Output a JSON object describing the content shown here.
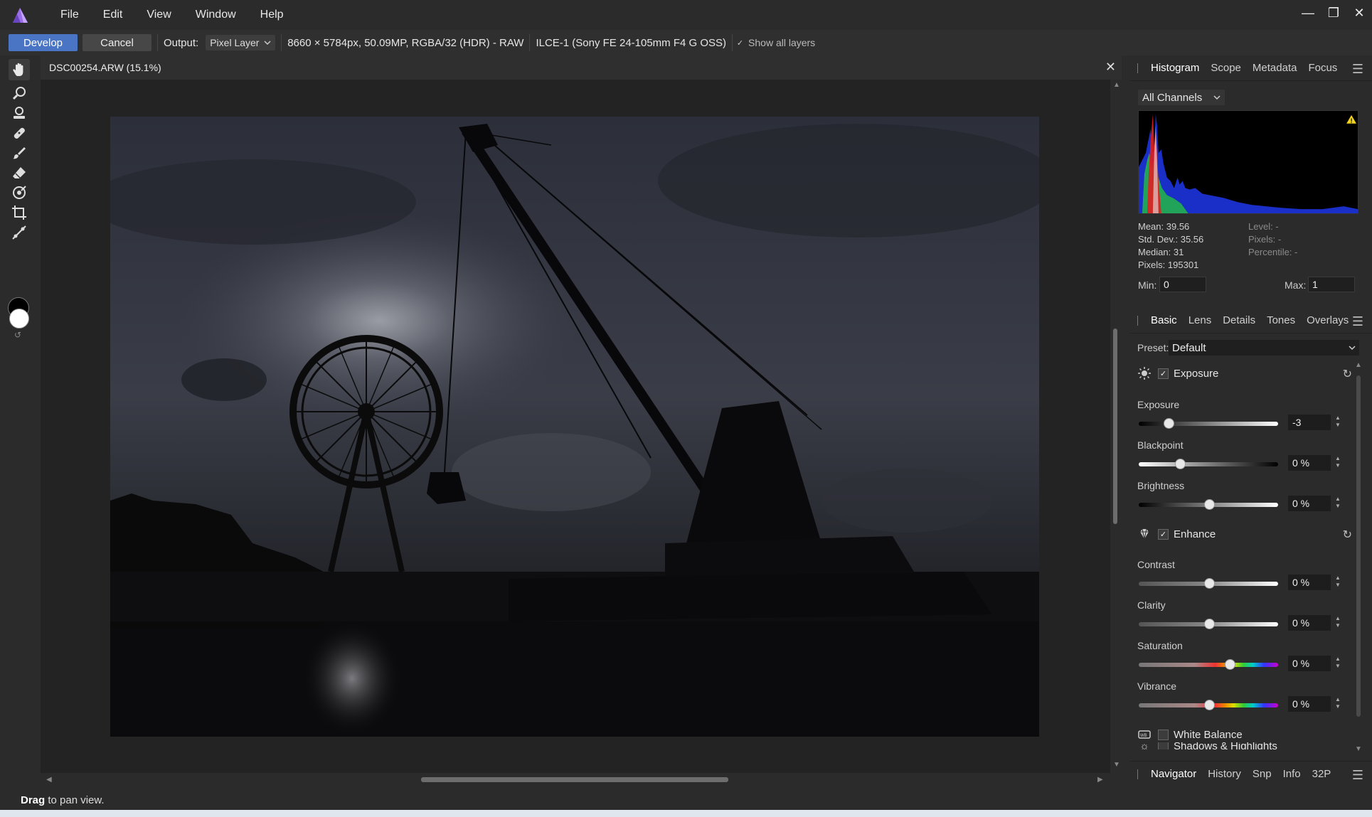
{
  "menu": {
    "items": [
      "File",
      "Edit",
      "View",
      "Window",
      "Help"
    ]
  },
  "window_controls": {
    "minimize": "—",
    "restore": "❐",
    "close": "✕"
  },
  "toolbar": {
    "develop_label": "Develop",
    "cancel_label": "Cancel",
    "output_label": "Output:",
    "output_value": "Pixel Layer",
    "image_info": "8660 × 5784px, 50.09MP, RGBA/32 (HDR) - RAW",
    "camera_info": "ILCE-1 (Sony FE 24-105mm F4 G OSS)",
    "show_layers_label": "Show all layers"
  },
  "tools": [
    {
      "name": "view-tool",
      "icon": "hand-icon",
      "active": true
    },
    {
      "name": "red-eye-tool",
      "icon": "magnifier-icon"
    },
    {
      "name": "overlay-gradient-tool",
      "icon": "stamp-icon"
    },
    {
      "name": "blemish-tool",
      "icon": "bandage-icon"
    },
    {
      "name": "overlay-paint-tool",
      "icon": "brush-icon"
    },
    {
      "name": "overlay-erase-tool",
      "icon": "eraser-icon"
    },
    {
      "name": "white-balance-tool",
      "icon": "target-icon"
    },
    {
      "name": "crop-tool",
      "icon": "crop-icon"
    },
    {
      "name": "straighten-tool",
      "icon": "straighten-icon"
    }
  ],
  "document": {
    "title": "DSC00254.ARW (15.1%)"
  },
  "status": {
    "bold": "Drag",
    "text": " to pan view."
  },
  "histogram_panel": {
    "tabs": [
      "Histogram",
      "Scope",
      "Metadata",
      "Focus"
    ],
    "active_tab": "Histogram",
    "channel": "All Channels",
    "stats": {
      "mean": "Mean: 39.56",
      "std_dev": "Std. Dev.: 35.56",
      "median": "Median: 31",
      "pixels": "Pixels: 195301",
      "level": "Level: -",
      "pixels_r": "Pixels: -",
      "percentile": "Percentile: -"
    },
    "min_label": "Min:",
    "min_value": "0",
    "max_label": "Max:",
    "max_value": "1",
    "warning_color": "#f2d21b"
  },
  "develop_panel": {
    "tabs": [
      "Basic",
      "Lens",
      "Details",
      "Tones",
      "Overlays"
    ],
    "active_tab": "Basic",
    "preset_label": "Preset:",
    "preset_value": "Default",
    "sections": {
      "exposure": {
        "title": "Exposure",
        "enabled": true,
        "sliders": [
          {
            "label": "Exposure",
            "value": "-3",
            "position": 0.22
          },
          {
            "label": "Blackpoint",
            "value": "0 %",
            "position": 0.3
          },
          {
            "label": "Brightness",
            "value": "0 %",
            "position": 0.51
          }
        ]
      },
      "enhance": {
        "title": "Enhance",
        "enabled": true,
        "sliders": [
          {
            "label": "Contrast",
            "value": "0 %",
            "position": 0.51
          },
          {
            "label": "Clarity",
            "value": "0 %",
            "position": 0.51
          },
          {
            "label": "Saturation",
            "value": "0 %",
            "position": 0.66
          },
          {
            "label": "Vibrance",
            "value": "0 %",
            "position": 0.51
          }
        ]
      },
      "white_balance": {
        "title": "White Balance",
        "enabled": false
      },
      "shadows_highlights": {
        "title": "Shadows & Highlights",
        "enabled": false
      }
    }
  },
  "bottom_panel": {
    "tabs": [
      "Navigator",
      "History",
      "Snp",
      "Info",
      "32P"
    ]
  },
  "colors": {
    "accent": "#4a74c4",
    "app_logo": "#9b6ee8",
    "background": "#2b2b2b",
    "canvas": "#232323"
  }
}
